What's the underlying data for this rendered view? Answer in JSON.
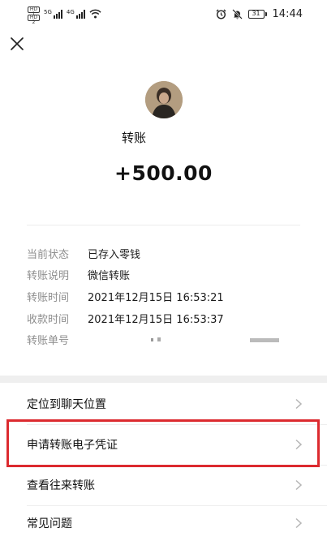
{
  "status_bar": {
    "sim1": "HD 1",
    "sim2": "HD 2",
    "net1": "5G",
    "net2": "4G",
    "battery": "31",
    "time": "14:44"
  },
  "header": {
    "title": "转账",
    "amount": "+500.00"
  },
  "details": [
    {
      "label": "当前状态",
      "value": "已存入零钱"
    },
    {
      "label": "转账说明",
      "value": "微信转账"
    },
    {
      "label": "转账时间",
      "value": "2021年12月15日 16:53:21"
    },
    {
      "label": "收款时间",
      "value": "2021年12月15日 16:53:37"
    },
    {
      "label": "转账单号",
      "value": ""
    }
  ],
  "menu": [
    {
      "label": "定位到聊天位置"
    },
    {
      "label": "申请转账电子凭证"
    },
    {
      "label": "查看往来转账"
    },
    {
      "label": "常见问题"
    }
  ],
  "colors": {
    "highlight_border": "#dc2a2f",
    "label_gray": "#8e8e8e",
    "section_gap": "#efefef"
  },
  "icons": {
    "close": "close-icon",
    "chevron": "chevron-right-icon",
    "wifi": "wifi-icon",
    "alarm": "alarm-icon",
    "mute": "bell-off-icon"
  }
}
